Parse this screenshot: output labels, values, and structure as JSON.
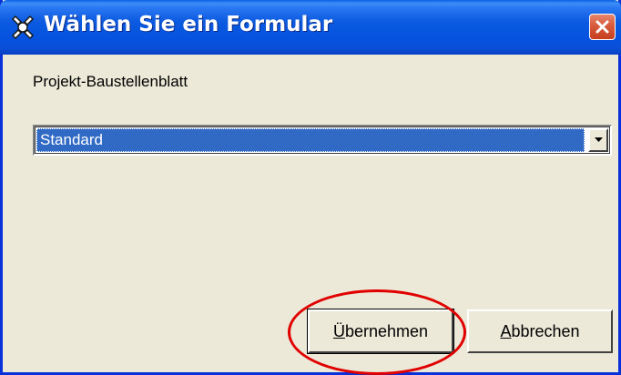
{
  "window": {
    "title": "Wählen Sie ein Formular",
    "icon": "app-icon",
    "close_icon": "close-icon"
  },
  "form": {
    "label": "Projekt-Baustellenblatt",
    "combo_value": "Standard",
    "dropdown_icon": "chevron-down-icon"
  },
  "buttons": {
    "apply_first": "Ü",
    "apply_rest": "bernehmen",
    "cancel_first": "A",
    "cancel_rest": "bbrechen"
  },
  "colors": {
    "titlebar": "#0553e0",
    "selection": "#316ac5",
    "dialog_bg": "#ece9d8",
    "highlight_circle": "#e10000"
  }
}
